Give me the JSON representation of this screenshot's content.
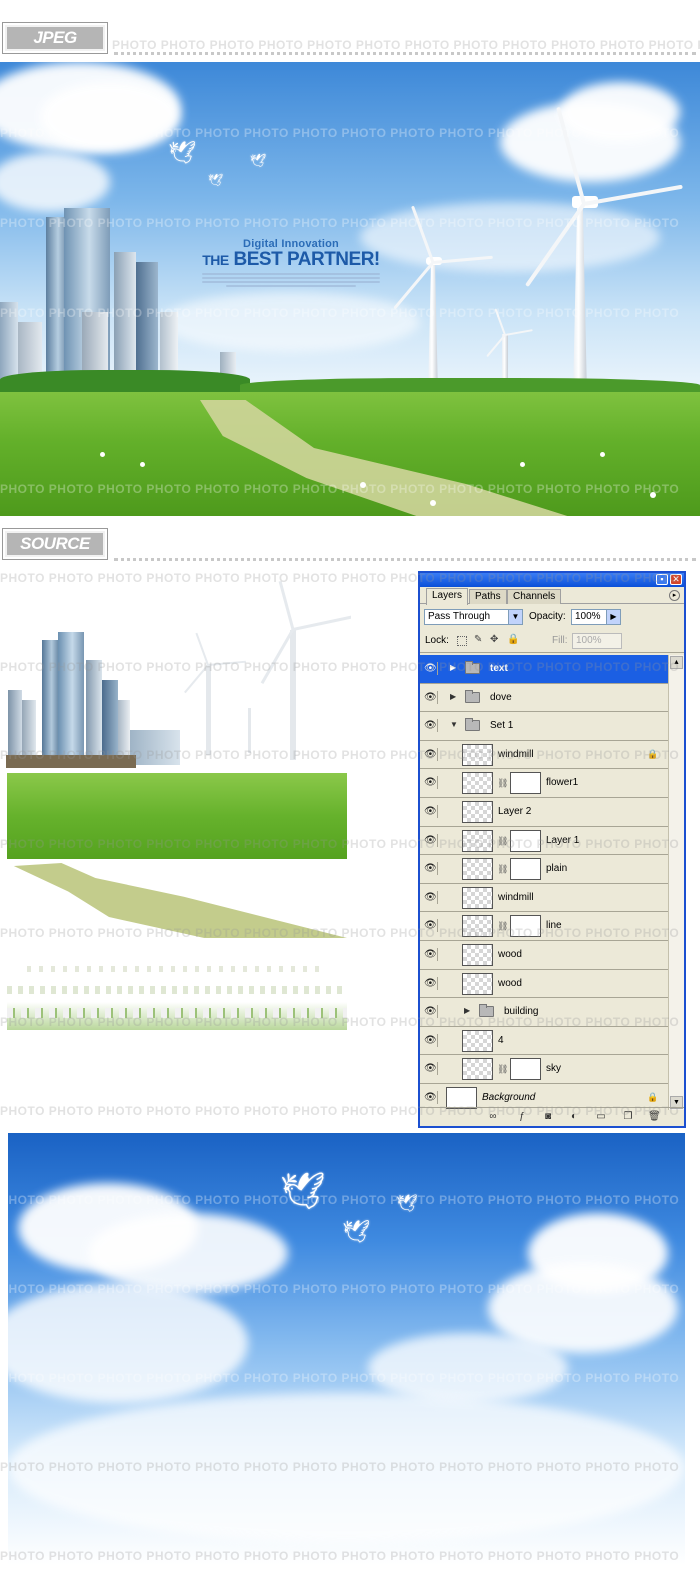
{
  "sections": {
    "jpeg_label": "JPEG",
    "source_label": "SOURCE"
  },
  "watermark": "PHOTO",
  "hero": {
    "subtitle": "Digital Innovation",
    "title_pre": "THE",
    "title_main": "BEST PARTNER!"
  },
  "panel": {
    "tabs": [
      "Layers",
      "Paths",
      "Channels"
    ],
    "blend_mode": "Pass Through",
    "opacity_label": "Opacity:",
    "opacity_value": "100%",
    "lock_label": "Lock:",
    "fill_label": "Fill:",
    "fill_value": "100%",
    "layers": [
      {
        "name": "text",
        "kind": "group",
        "selected": true
      },
      {
        "name": "dove",
        "kind": "group"
      },
      {
        "name": "Set 1",
        "kind": "group-open"
      },
      {
        "name": "windmill",
        "kind": "layer",
        "locked": true
      },
      {
        "name": "flower1",
        "kind": "layer-mask"
      },
      {
        "name": "Layer 2",
        "kind": "layer"
      },
      {
        "name": "Layer 1",
        "kind": "layer-mask"
      },
      {
        "name": "plain",
        "kind": "layer-mask"
      },
      {
        "name": "windmill",
        "kind": "layer"
      },
      {
        "name": "line",
        "kind": "layer-mask"
      },
      {
        "name": "wood",
        "kind": "layer"
      },
      {
        "name": "wood",
        "kind": "layer"
      },
      {
        "name": "building",
        "kind": "group-nested"
      },
      {
        "name": "4",
        "kind": "layer"
      },
      {
        "name": "sky",
        "kind": "layer-mask"
      },
      {
        "name": "Background",
        "kind": "background",
        "locked": true
      }
    ]
  },
  "colors": {
    "panel_border": "#1b4fd0",
    "selected_layer": "#1b5fe3",
    "grass": "#63b02a",
    "sky_top": "#1a62c4"
  },
  "icons": {
    "visibility": "eye-icon",
    "group": "folder-icon",
    "lock": "lock-icon",
    "link": "chain-link-icon"
  }
}
